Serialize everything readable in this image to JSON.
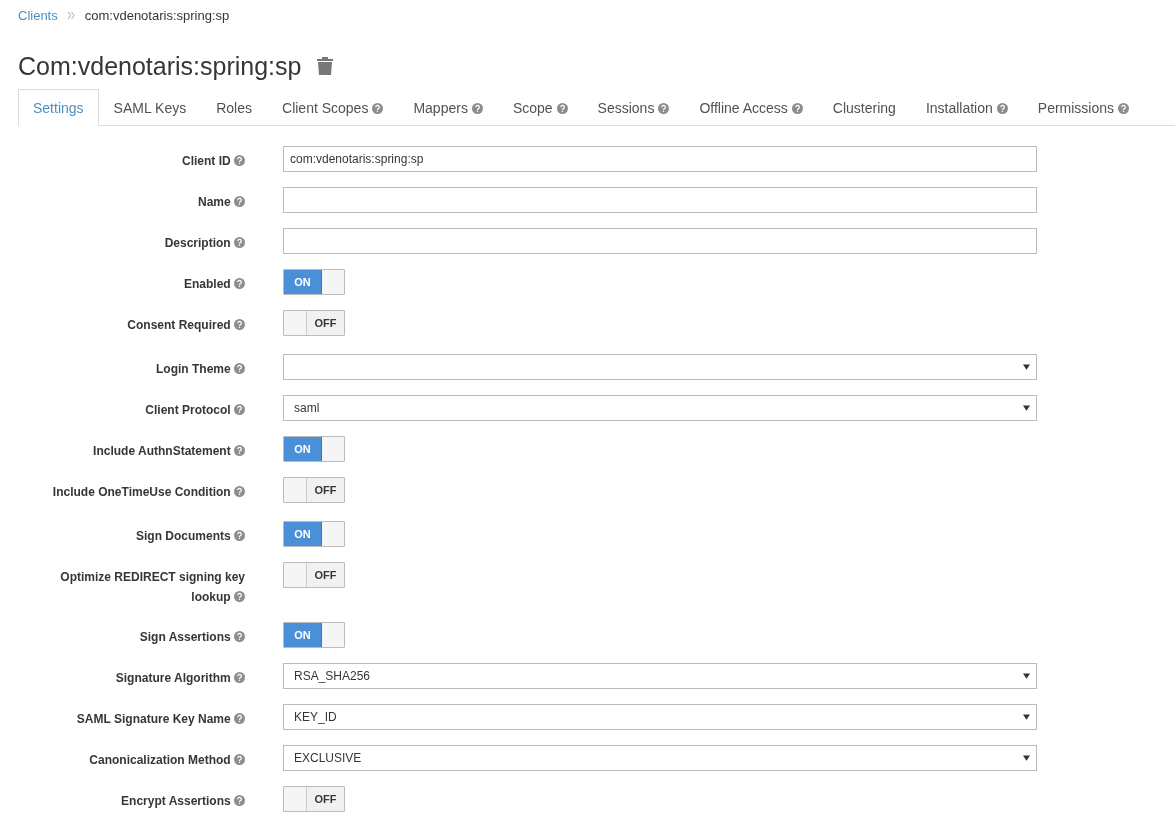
{
  "breadcrumb": [
    {
      "label": "Clients",
      "link": true
    },
    {
      "label": "com:vdenotaris:spring:sp",
      "link": false
    }
  ],
  "title": "Com:vdenotaris:spring:sp",
  "tabs": [
    {
      "label": "Settings",
      "selected": true,
      "help": false
    },
    {
      "label": "SAML Keys",
      "selected": false,
      "help": false
    },
    {
      "label": "Roles",
      "selected": false,
      "help": false
    },
    {
      "label": "Client Scopes",
      "selected": false,
      "help": true
    },
    {
      "label": "Mappers",
      "selected": false,
      "help": true
    },
    {
      "label": "Scope",
      "selected": false,
      "help": true
    },
    {
      "label": "Sessions",
      "selected": false,
      "help": true
    },
    {
      "label": "Offline Access",
      "selected": false,
      "help": true
    },
    {
      "label": "Clustering",
      "selected": false,
      "help": false
    },
    {
      "label": "Installation",
      "selected": false,
      "help": true
    },
    {
      "label": "Permissions",
      "selected": false,
      "help": true
    }
  ],
  "fields": [
    {
      "label": "Client ID",
      "kind": "text",
      "value": "com:vdenotaris:spring:sp"
    },
    {
      "label": "Name",
      "kind": "text"
    },
    {
      "label": "Description",
      "kind": "text"
    },
    {
      "label": "Enabled",
      "kind": "switch",
      "on": true,
      "text": "ON"
    },
    {
      "label": "Consent Required",
      "kind": "switch",
      "on": false,
      "text": "OFF"
    },
    {
      "label": "Login Theme",
      "kind": "select"
    },
    {
      "label": "Client Protocol",
      "kind": "select",
      "value": "saml"
    },
    {
      "label": "Include AuthnStatement",
      "kind": "switch",
      "on": true,
      "text": "ON"
    },
    {
      "label": "Include OneTimeUse Condition",
      "kind": "switch",
      "on": false,
      "text": "OFF"
    },
    {
      "label": "Sign Documents",
      "kind": "switch",
      "on": true,
      "text": "ON"
    },
    {
      "label": "Optimize REDIRECT signing key lookup",
      "kind": "switch",
      "on": false,
      "text": "OFF"
    },
    {
      "label": "Sign Assertions",
      "kind": "switch",
      "on": true,
      "text": "ON"
    },
    {
      "label": "Signature Algorithm",
      "kind": "select",
      "value": "RSA_SHA256"
    },
    {
      "label": "SAML Signature Key Name",
      "kind": "select",
      "value": "KEY_ID"
    },
    {
      "label": "Canonicalization Method",
      "kind": "select",
      "value": "EXCLUSIVE"
    },
    {
      "label": "Encrypt Assertions",
      "kind": "switch",
      "on": false,
      "text": "OFF"
    }
  ]
}
